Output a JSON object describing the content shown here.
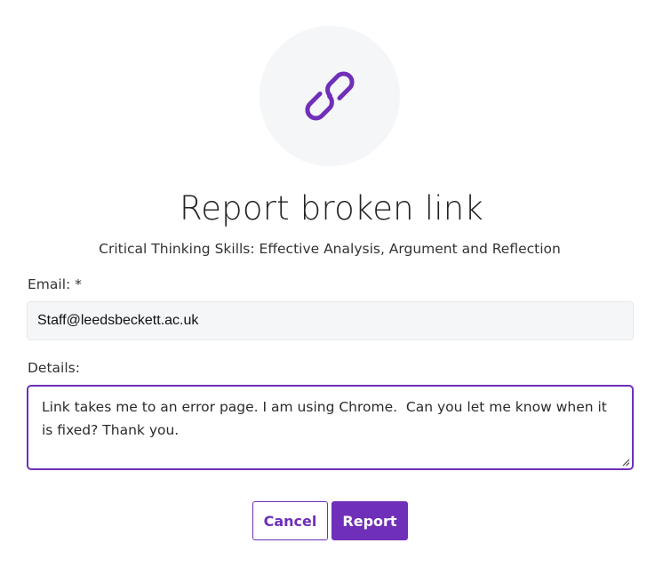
{
  "dialog": {
    "icon": "link-icon",
    "title": "Report broken link",
    "subtitle": "Critical Thinking Skills: Effective Analysis, Argument and Reflection"
  },
  "form": {
    "email_label": "Email: *",
    "email_value": "Staff@leedsbeckett.ac.uk",
    "details_label": "Details:",
    "details_value": "Link takes me to an error page. I am using Chrome.  Can you let me know when it is fixed? Thank you."
  },
  "actions": {
    "cancel_label": "Cancel",
    "report_label": "Report"
  },
  "colors": {
    "accent": "#6f2fb8",
    "icon_background": "#f5f6f8",
    "input_background": "#f5f6f8"
  }
}
